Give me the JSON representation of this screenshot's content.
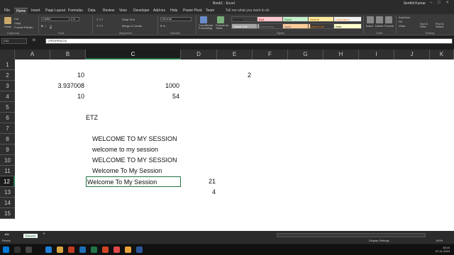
{
  "titlebar": {
    "title": "Book1 - Excel",
    "user": "Senthil Kumar"
  },
  "tabs": [
    "File",
    "Home",
    "Insert",
    "Page Layout",
    "Formulas",
    "Data",
    "Review",
    "View",
    "Developer",
    "Add-ins",
    "Help",
    "Power Pivot",
    "Team"
  ],
  "tell_me": "Tell me what you want to do",
  "ribbon": {
    "clipboard": {
      "paste": "Paste",
      "cut": "Cut",
      "copy": "Copy",
      "format_painter": "Format Painter",
      "label": "Clipboard"
    },
    "font": {
      "name": "Calibri",
      "size": "11",
      "label": "Font"
    },
    "alignment": {
      "wrap": "Wrap Text",
      "merge": "Merge & Center",
      "label": "Alignment"
    },
    "number": {
      "format": "General",
      "label": "Number"
    },
    "styles": {
      "conditional": "Conditional Formatting",
      "format_table": "Format as Table",
      "items": [
        {
          "label": "Normal",
          "bg": "#ffffff"
        },
        {
          "label": "Bad",
          "bg": "#ffc7ce"
        },
        {
          "label": "Good",
          "bg": "#c6efce"
        },
        {
          "label": "Neutral",
          "bg": "#ffeb9c"
        },
        {
          "label": "Calculation",
          "bg": "#f2f2f2"
        },
        {
          "label": "Check Cell",
          "bg": "#a5a5a5"
        },
        {
          "label": "Explanatory...",
          "bg": "#ffffff"
        },
        {
          "label": "Input",
          "bg": "#ffcc99"
        },
        {
          "label": "Linked Cell",
          "bg": "#ffffff"
        },
        {
          "label": "Note",
          "bg": "#ffffcc"
        }
      ],
      "label": "Styles"
    },
    "cells": {
      "insert": "Insert",
      "delete": "Delete",
      "format": "Format",
      "label": "Cells"
    },
    "editing": {
      "autosum": "AutoSum",
      "fill": "Fill",
      "clear": "Clear",
      "sort": "Sort & Filter",
      "find": "Find & Select",
      "label": "Editing"
    }
  },
  "formula_bar": {
    "name_box": "C12",
    "formula": "=PROPER(C9)"
  },
  "columns": [
    "A",
    "B",
    "C",
    "D",
    "E",
    "F",
    "G",
    "H",
    "I",
    "J",
    "K"
  ],
  "rows": [
    "1",
    "2",
    "3",
    "4",
    "5",
    "6",
    "7",
    "8",
    "9",
    "10",
    "11",
    "12",
    "13",
    "14",
    "15"
  ],
  "cells": [
    {
      "ref": "B2",
      "value": "10"
    },
    {
      "ref": "E2",
      "value": "2"
    },
    {
      "ref": "B3",
      "value": "3.937008"
    },
    {
      "ref": "C3",
      "value": "1000"
    },
    {
      "ref": "B4",
      "value": "10"
    },
    {
      "ref": "C4",
      "value": "54"
    },
    {
      "ref": "B6",
      "value": "ETZ"
    },
    {
      "ref": "B8",
      "value": "WELCOME TO MY SESSION"
    },
    {
      "ref": "B9",
      "value": "welcome to my session"
    },
    {
      "ref": "B10",
      "value": "WELCOME TO MY SESSION"
    },
    {
      "ref": "B11",
      "value": "Welcome To My Session"
    },
    {
      "ref": "C12",
      "value": "Welcome To My Session"
    },
    {
      "ref": "D12",
      "value": "21"
    },
    {
      "ref": "D13",
      "value": "4"
    }
  ],
  "sheet_tabs": [
    "Sheet1"
  ],
  "status": {
    "ready": "Ready",
    "display": "Display Settings",
    "zoom": "100%"
  },
  "taskbar": {
    "time": "18:16",
    "date": "07-11-2019"
  }
}
